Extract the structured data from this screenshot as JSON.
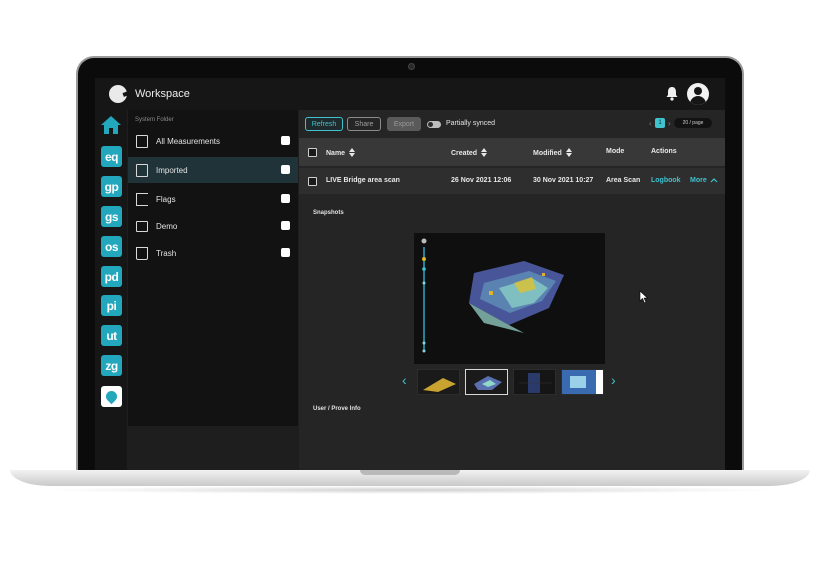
{
  "header": {
    "title": "Workspace"
  },
  "rail": {
    "apps": [
      {
        "label": "eq"
      },
      {
        "label": "gp"
      },
      {
        "label": "gs"
      },
      {
        "label": "os"
      },
      {
        "label": "pd"
      },
      {
        "label": "pi"
      },
      {
        "label": "ut"
      },
      {
        "label": "zg"
      }
    ]
  },
  "folders": {
    "section_label": "System Folder",
    "items": [
      {
        "label": "All Measurements"
      },
      {
        "label": "Imported"
      },
      {
        "label": "Flags"
      },
      {
        "label": "Demo"
      },
      {
        "label": "Trash"
      }
    ]
  },
  "toolbar": {
    "refresh": "Refresh",
    "share": "Share",
    "export": "Export",
    "sync_label": "Partially synced",
    "page": "1",
    "per_page": "20 / page"
  },
  "table": {
    "headers": {
      "name": "Name",
      "created": "Created",
      "modified": "Modified",
      "mode": "Mode",
      "actions": "Actions"
    },
    "rows": [
      {
        "name": "LIVE Bridge area scan",
        "created": "26 Nov 2021 12:06",
        "modified": "30 Nov 2021 10:27",
        "mode": "Area Scan",
        "logbook": "Logbook",
        "more": "More"
      }
    ]
  },
  "detail": {
    "snapshots_label": "Snapshots",
    "user_info_label": "User / Prove Info"
  },
  "colors": {
    "accent": "#3fc3cf",
    "rail": "#22a7bd",
    "background": "#252525"
  }
}
